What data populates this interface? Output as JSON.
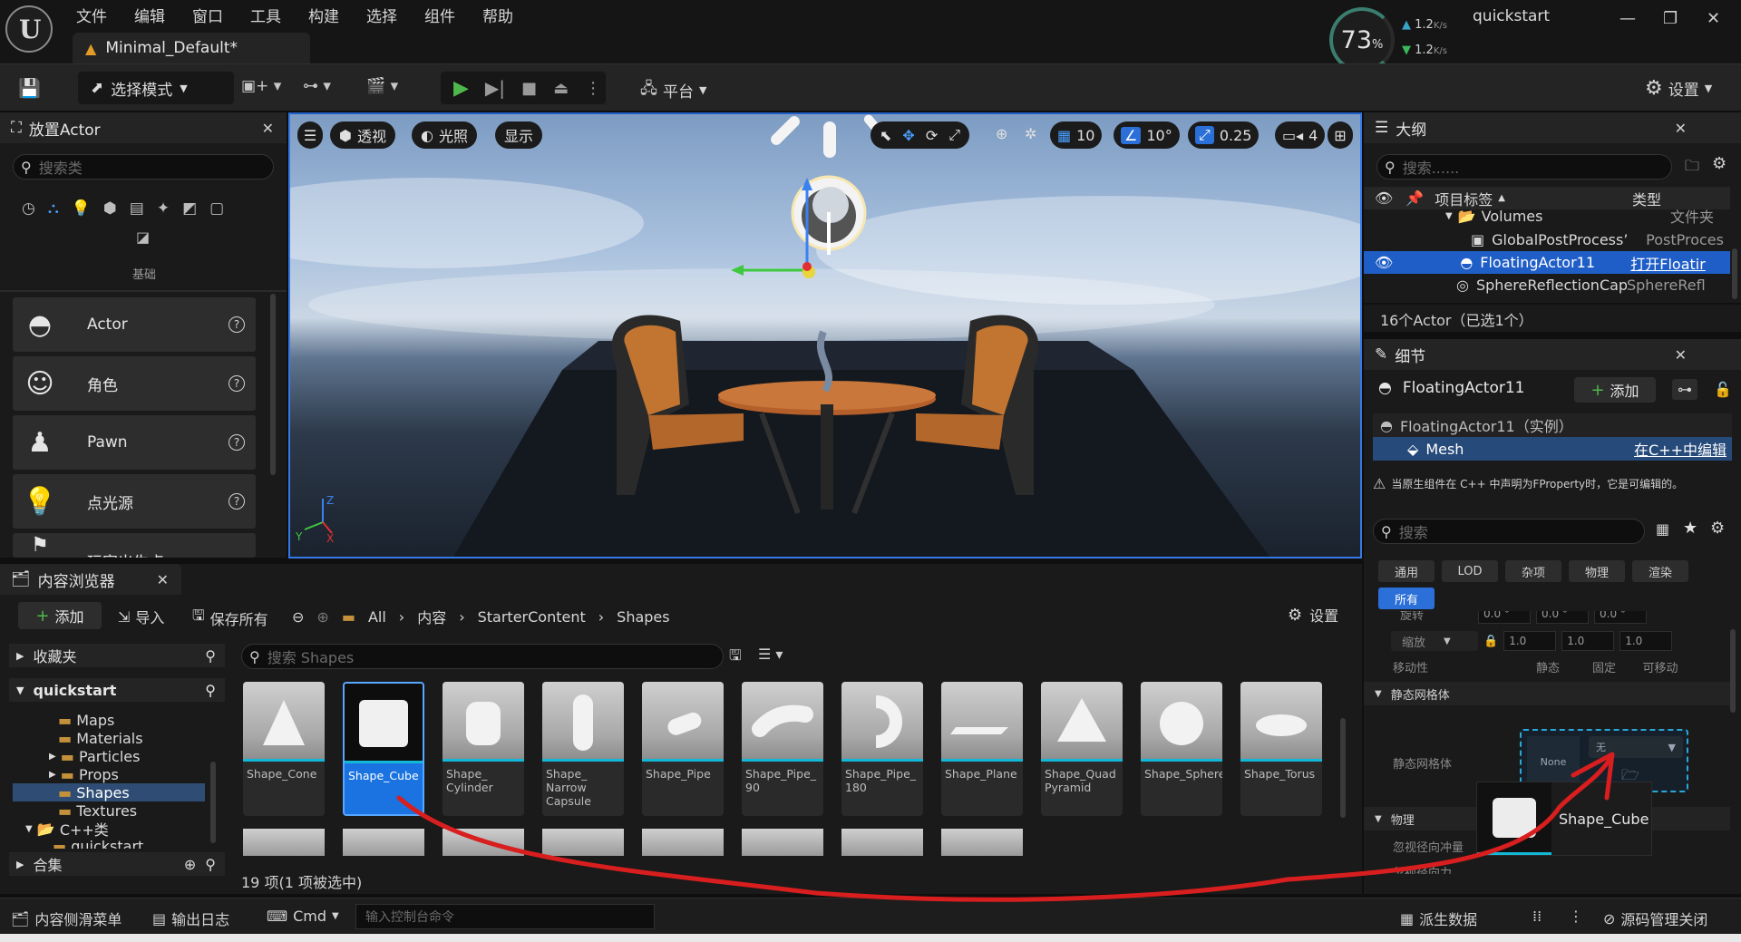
{
  "menu": [
    "文件",
    "编辑",
    "窗口",
    "工具",
    "构建",
    "选择",
    "组件",
    "帮助"
  ],
  "doc_tab": "Minimal_Default*",
  "perf": {
    "percent": "73",
    "unit": "%",
    "up": "1.2",
    "down": "1.2",
    "rate_unit": "K/s"
  },
  "project_name": "quickstart",
  "toolbar": {
    "select_mode": "选择模式",
    "platform": "平台",
    "settings": "设置"
  },
  "place_actors": {
    "title": "放置Actor",
    "search_placeholder": "搜索类",
    "category_label": "基础",
    "items": [
      "Actor",
      "角色",
      "Pawn",
      "点光源",
      "玩家出生点"
    ]
  },
  "viewport": {
    "perspective": "透视",
    "lighting": "光照",
    "show": "显示",
    "grid_snap": "10",
    "rotate_snap": "10°",
    "scale_snap": "0.25",
    "camera_speed": "4"
  },
  "outliner": {
    "title": "大纲",
    "search_placeholder": "搜索......",
    "col_label": "项目标签",
    "col_type": "类型",
    "rows": [
      {
        "label": "Volumes",
        "type": "文件夹"
      },
      {
        "label": "GlobalPostProcess’",
        "type": "PostProces"
      },
      {
        "label": "FloatingActor11",
        "type": "打开Floatir"
      },
      {
        "label": "SphereReflectionCapt",
        "type": "SphereRefl"
      }
    ],
    "summary": "16个Actor（已选1个）"
  },
  "details": {
    "title": "细节",
    "actor_name": "FloatingActor11",
    "add_label": "添加",
    "instance_label": "FloatingActor11（实例）",
    "component": "Mesh",
    "edit_cpp": "在C++中编辑",
    "notice": "当原生组件在 C++ 中声明为FProperty时，它是可编辑的。",
    "search_placeholder": "搜索",
    "categories": [
      "通用",
      "LOD",
      "杂项",
      "物理",
      "渲染"
    ],
    "all_label": "所有",
    "rotation_label": "旋转",
    "rotation": [
      "0.0 °",
      "0.0 °",
      "0.0 °"
    ],
    "scale_label": "缩放",
    "scale": [
      "1.0",
      "1.0",
      "1.0"
    ],
    "mobility_label": "移动性",
    "mobility": [
      "静态",
      "固定",
      "可移动"
    ],
    "static_mesh_section": "静态网格体",
    "static_mesh_label": "静态网格体",
    "mesh_none": "None",
    "mesh_select": "无",
    "physics_section": "物理",
    "physics_row1": "忽视径向冲量",
    "physics_row2": "忽视径向力",
    "drag_tooltip": "Shape_Cube"
  },
  "content_browser": {
    "title": "内容浏览器",
    "add_label": "添加",
    "import_label": "导入",
    "save_all_label": "保存所有",
    "breadcrumb": [
      "All",
      "内容",
      "StarterContent",
      "Shapes"
    ],
    "settings_label": "设置",
    "favorites_label": "收藏夹",
    "project_label": "quickstart",
    "folders": [
      "Maps",
      "Materials",
      "Particles",
      "Props",
      "Shapes",
      "Textures"
    ],
    "cpp_folder": "C++类",
    "cpp_sub": "quickstart",
    "collections_label": "合集",
    "search_placeholder": "搜索 Shapes",
    "assets": [
      "Shape_Cone",
      "Shape_Cube",
      "Shape_ Cylinder",
      "Shape_ Narrow Capsule",
      "Shape_Pipe",
      "Shape_Pipe_ 90",
      "Shape_Pipe_ 180",
      "Shape_Plane",
      "Shape_Quad Pyramid",
      "Shape_Sphere",
      "Shape_Torus"
    ],
    "count_label": "19 项(1 项被选中)"
  },
  "statusbar": {
    "drawer": "内容侧滑菜单",
    "output_log": "输出日志",
    "cmd": "Cmd",
    "console_placeholder": "输入控制台命令",
    "derived_data": "派生数据",
    "source_control": "源码管理关闭"
  },
  "colors": {
    "accent": "#2b6fd8",
    "play": "#4fb84c",
    "selection": "#1a73e0",
    "annotation": "#d81e1e"
  }
}
